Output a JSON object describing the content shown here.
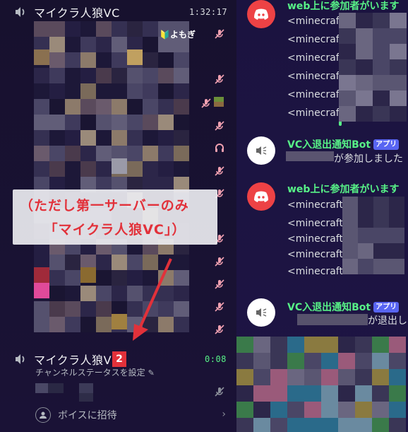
{
  "colors": {
    "accent_green": "#57f287",
    "annotation_red": "#e2313a",
    "discord_red": "#ed4245",
    "app_tag_blue": "#5865f2",
    "mute_icon_pink": "#f0a0b0"
  },
  "voice_channels": [
    {
      "name": "マイクラ人狼VC",
      "timer": "1:32:17",
      "user_tag": "🔰よもぎ"
    },
    {
      "name": "マイクラ人狼VC",
      "name_suffix_highlight": "2",
      "timer": "0:08",
      "status_prompt": "チャンネルステータスを設定",
      "invite_label": "ボイスに招待"
    }
  ],
  "annotation": {
    "line1": "（ただし第一サーバーのみ",
    "line2": "「マイクラ人狼VC」）"
  },
  "chat": {
    "messages": [
      {
        "author": "web上に参加者がいます",
        "avatar": "discord-icon",
        "lines": [
          "<minecraft",
          "<minecraft",
          "<minecraft",
          "<minecraft",
          "<minecraft",
          "<minecraft"
        ]
      },
      {
        "author": "VC入退出通知Bot",
        "app_tag": "アプリ",
        "avatar": "speaker-bot-icon",
        "text": "が参加しました"
      },
      {
        "author": "web上に参加者がいます",
        "avatar": "discord-icon",
        "lines": [
          "<minecraft:",
          "<minecraft:",
          "<minecraft:",
          "<minecraft:",
          "<minecraft:"
        ]
      },
      {
        "author": "VC入退出通知Bot",
        "app_tag": "アプリ",
        "avatar": "speaker-bot-icon",
        "text": "が退出し"
      }
    ]
  }
}
